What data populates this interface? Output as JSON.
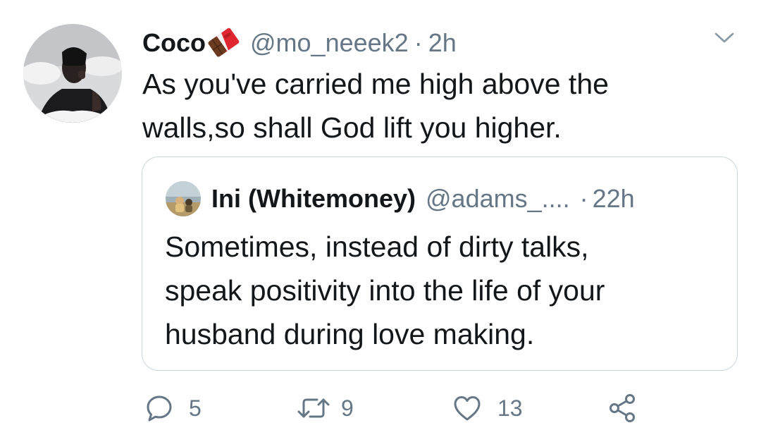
{
  "tweet": {
    "author": {
      "display_name": "Coco",
      "name_emoji": "chocolate-bar-emoji",
      "handle": "@mo_neeek2",
      "time": "2h"
    },
    "separator": "·",
    "text": "As you've carried me high above the\nwalls,so shall God lift you higher.",
    "menu_icon": "chevron-down-icon"
  },
  "quoted_tweet": {
    "author": {
      "display_name": "Ini (Whitemoney)",
      "handle": "@adams_....",
      "time": "22h"
    },
    "separator": "·",
    "text": "Sometimes, instead of dirty talks,\nspeak positivity into the life of your\nhusband during love making."
  },
  "actions": {
    "reply": {
      "icon": "reply-icon",
      "count": "5"
    },
    "retweet": {
      "icon": "retweet-icon",
      "count": "9"
    },
    "like": {
      "icon": "heart-icon",
      "count": "13"
    },
    "share": {
      "icon": "share-icon"
    }
  },
  "colors": {
    "text_primary": "#14171a",
    "text_secondary": "#657786",
    "border": "#ccd6dd"
  }
}
